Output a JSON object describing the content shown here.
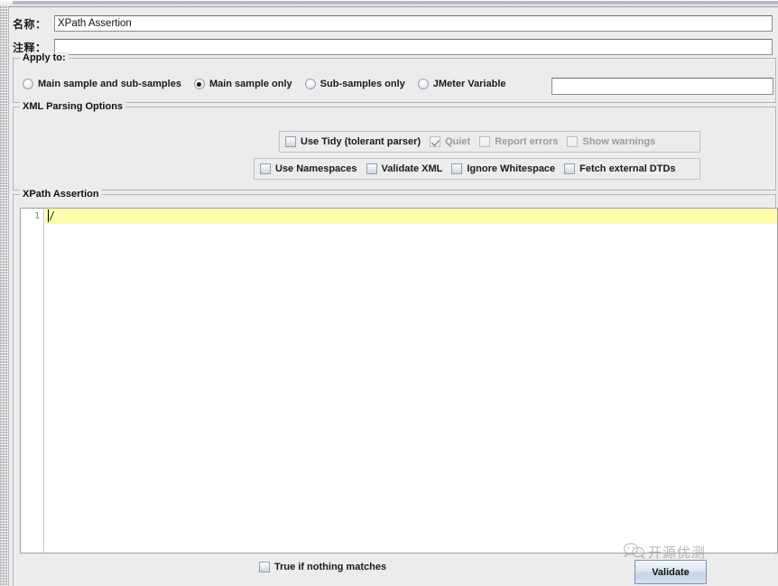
{
  "window": {
    "title_bar": ""
  },
  "header": {
    "name_label": "名称：",
    "name_value": "XPath Assertion",
    "comment_label": "注释：",
    "comment_value": ""
  },
  "apply_to": {
    "title": "Apply to:",
    "options": [
      {
        "label": "Main sample and sub-samples",
        "selected": false
      },
      {
        "label": "Main sample only",
        "selected": true
      },
      {
        "label": "Sub-samples only",
        "selected": false
      },
      {
        "label": "JMeter Variable",
        "selected": false
      }
    ],
    "variable_value": "",
    "variable_placeholder": ""
  },
  "xml_parsing_options": {
    "title": "XML Parsing Options",
    "row1": [
      {
        "label": "Use Tidy (tolerant parser)",
        "checked": false,
        "disabled": false
      },
      {
        "label": "Quiet",
        "checked": true,
        "disabled": true
      },
      {
        "label": "Report errors",
        "checked": false,
        "disabled": true
      },
      {
        "label": "Show warnings",
        "checked": false,
        "disabled": true
      }
    ],
    "row2": [
      {
        "label": "Use Namespaces",
        "checked": false,
        "disabled": false
      },
      {
        "label": "Validate XML",
        "checked": false,
        "disabled": false
      },
      {
        "label": "Ignore Whitespace",
        "checked": false,
        "disabled": false
      },
      {
        "label": "Fetch external DTDs",
        "checked": false,
        "disabled": false
      }
    ]
  },
  "xpath_assertion": {
    "title": "XPath Assertion",
    "line_number": "1",
    "expression": "/"
  },
  "footer": {
    "true_if_nothing_matches_label": "True if nothing matches",
    "true_if_nothing_matches_checked": false,
    "validate_label": "Validate"
  },
  "watermark": {
    "text": "开源优测",
    "icon": "wechat-icon"
  },
  "colors": {
    "panel_bg": "#ececed",
    "field_bg": "#ffffff",
    "active_line": "#fdfdac",
    "button_accent": "#c6d4e8",
    "border": "#b4b4b8"
  }
}
